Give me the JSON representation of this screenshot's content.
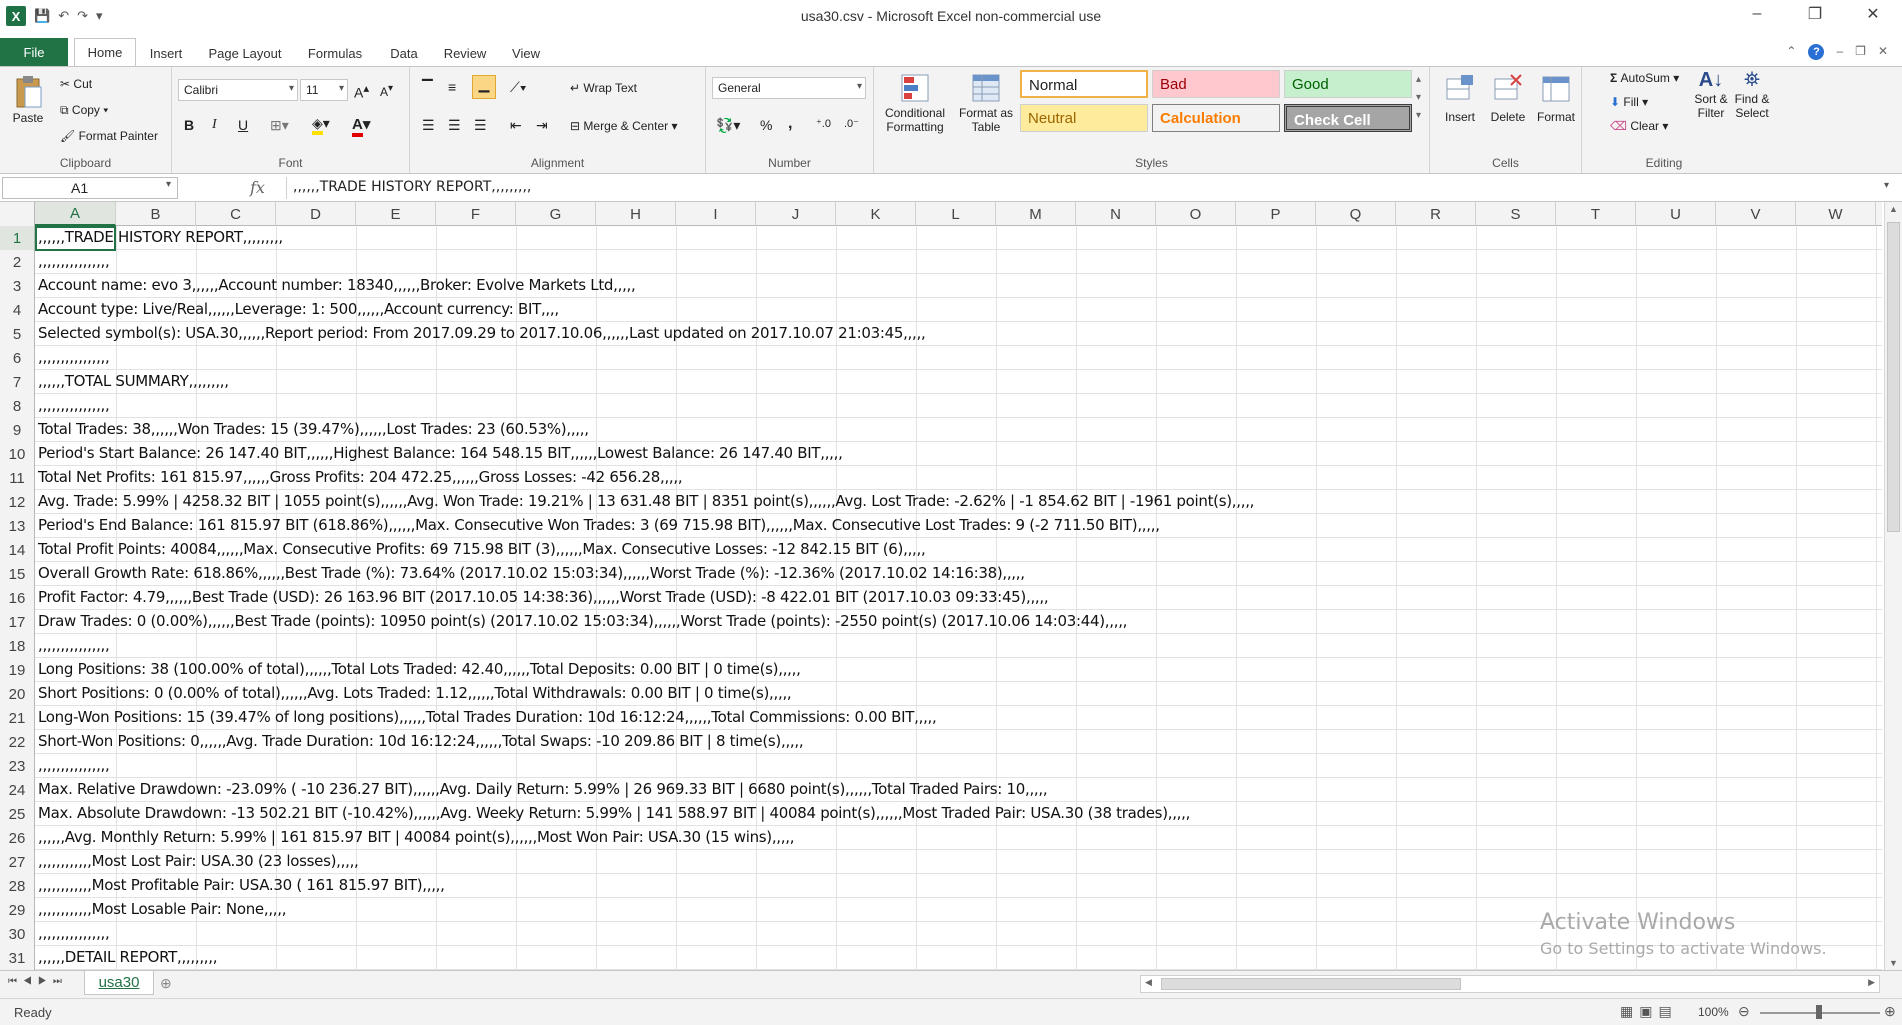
{
  "window": {
    "title": "usa30.csv - Microsoft Excel non-commercial use"
  },
  "tabs": {
    "file": "File",
    "home": "Home",
    "insert": "Insert",
    "page_layout": "Page Layout",
    "formulas": "Formulas",
    "data": "Data",
    "review": "Review",
    "view": "View"
  },
  "ribbon": {
    "clipboard": {
      "paste": "Paste",
      "cut": "Cut",
      "copy": "Copy",
      "format_painter": "Format Painter",
      "label": "Clipboard"
    },
    "font": {
      "name": "Calibri",
      "size": "11",
      "bold": "B",
      "italic": "I",
      "underline": "U",
      "label": "Font"
    },
    "alignment": {
      "wrap": "Wrap Text",
      "merge": "Merge & Center",
      "label": "Alignment"
    },
    "number": {
      "format": "General",
      "percent": "%",
      "comma": ",",
      "label": "Number"
    },
    "styles": {
      "conditional": [
        "Conditional",
        "Formatting"
      ],
      "format_as": [
        "Format as",
        "Table"
      ],
      "normal": "Normal",
      "bad": "Bad",
      "good": "Good",
      "neutral": "Neutral",
      "calculation": "Calculation",
      "check_cell": "Check Cell",
      "label": "Styles"
    },
    "cells": {
      "insert": "Insert",
      "delete": "Delete",
      "format": "Format",
      "label": "Cells"
    },
    "editing": {
      "autosum": "AutoSum",
      "fill": "Fill",
      "clear": "Clear",
      "sort": [
        "Sort &",
        "Filter"
      ],
      "find": [
        "Find &",
        "Select"
      ],
      "label": "Editing"
    }
  },
  "formula_bar": {
    "name_box": "A1",
    "fx": "fx",
    "content": ",,,,,,TRADE HISTORY REPORT,,,,,,,,,"
  },
  "columns": [
    "A",
    "B",
    "C",
    "D",
    "E",
    "F",
    "G",
    "H",
    "I",
    "J",
    "K",
    "L",
    "M",
    "N",
    "O",
    "P",
    "Q",
    "R",
    "S",
    "T",
    "U",
    "V",
    "W"
  ],
  "rows": [
    {
      "n": "1",
      "text": ",,,,,,TRADE HISTORY REPORT,,,,,,,,,"
    },
    {
      "n": "2",
      "text": ",,,,,,,,,,,,,,,,"
    },
    {
      "n": "3",
      "text": "Account name: evo 3,,,,,,Account number: 18340,,,,,,Broker: Evolve Markets Ltd,,,,,"
    },
    {
      "n": "4",
      "text": "Account type: Live/Real,,,,,,Leverage: 1: 500,,,,,,Account currency: BIT,,,,"
    },
    {
      "n": "5",
      "text": "Selected symbol(s): USA.30,,,,,,Report period: From 2017.09.29 to 2017.10.06,,,,,,Last updated on 2017.10.07 21:03:45,,,,,"
    },
    {
      "n": "6",
      "text": ",,,,,,,,,,,,,,,,"
    },
    {
      "n": "7",
      "text": ",,,,,,TOTAL SUMMARY,,,,,,,,,"
    },
    {
      "n": "8",
      "text": ",,,,,,,,,,,,,,,,"
    },
    {
      "n": "9",
      "text": "Total Trades: 38,,,,,,Won Trades: 15 (39.47%),,,,,,Lost Trades: 23 (60.53%),,,,,"
    },
    {
      "n": "10",
      "text": "Period's Start Balance: 26 147.40 BIT,,,,,,Highest Balance:  164 548.15 BIT,,,,,,Lowest Balance: 26 147.40 BIT,,,,,"
    },
    {
      "n": "11",
      "text": "Total Net Profits:  161 815.97,,,,,,Gross Profits:  204 472.25,,,,,,Gross Losses:  -42 656.28,,,,,"
    },
    {
      "n": "12",
      "text": "Avg. Trade: 5.99% | 4258.32 BIT | 1055 point(s),,,,,,Avg. Won Trade: 19.21% | 13 631.48 BIT | 8351 point(s),,,,,,Avg. Lost Trade: -2.62% | -1 854.62 BIT | -1961 point(s),,,,,"
    },
    {
      "n": "13",
      "text": "Period's End Balance:  161 815.97 BIT (618.86%),,,,,,Max. Consecutive Won Trades: 3 (69 715.98 BIT),,,,,,Max. Consecutive Lost Trades: 9 (-2 711.50 BIT),,,,,"
    },
    {
      "n": "14",
      "text": "Total Profit Points: 40084,,,,,,Max. Consecutive Profits: 69 715.98 BIT (3),,,,,,Max. Consecutive Losses:  -12 842.15 BIT (6),,,,,"
    },
    {
      "n": "15",
      "text": "Overall Growth Rate: 618.86%,,,,,,Best Trade (%): 73.64% (2017.10.02 15:03:34),,,,,,Worst Trade (%):  -12.36% (2017.10.02 14:16:38),,,,,"
    },
    {
      "n": "16",
      "text": "Profit Factor: 4.79,,,,,,Best Trade (USD): 26 163.96 BIT (2017.10.05 14:38:36),,,,,,Worst Trade (USD): -8 422.01 BIT (2017.10.03 09:33:45),,,,,"
    },
    {
      "n": "17",
      "text": "Draw Trades: 0 (0.00%),,,,,,Best Trade (points): 10950 point(s) (2017.10.02 15:03:34),,,,,,Worst Trade (points): -2550 point(s) (2017.10.06 14:03:44),,,,,"
    },
    {
      "n": "18",
      "text": ",,,,,,,,,,,,,,,,"
    },
    {
      "n": "19",
      "text": "Long Positions: 38 (100.00% of total),,,,,,Total Lots Traded: 42.40,,,,,,Total Deposits: 0.00 BIT | 0 time(s),,,,,"
    },
    {
      "n": "20",
      "text": "Short Positions: 0 (0.00% of total),,,,,,Avg. Lots Traded: 1.12,,,,,,Total Withdrawals: 0.00 BIT | 0 time(s),,,,,"
    },
    {
      "n": "21",
      "text": "Long-Won Positions: 15 (39.47% of long positions),,,,,,Total Trades Duration: 10d 16:12:24,,,,,,Total Commissions: 0.00 BIT,,,,,"
    },
    {
      "n": "22",
      "text": "Short-Won Positions: 0,,,,,,Avg. Trade Duration: 10d 16:12:24,,,,,,Total Swaps:  -10 209.86 BIT | 8 time(s),,,,,"
    },
    {
      "n": "23",
      "text": ",,,,,,,,,,,,,,,,"
    },
    {
      "n": "24",
      "text": "Max. Relative Drawdown: -23.09% ( -10 236.27 BIT),,,,,,Avg. Daily Return: 5.99% | 26 969.33 BIT | 6680 point(s),,,,,,Total Traded Pairs: 10,,,,,"
    },
    {
      "n": "25",
      "text": "Max. Absolute Drawdown:  -13 502.21 BIT (-10.42%),,,,,,Avg. Weeky Return: 5.99% |  141 588.97 BIT | 40084 point(s),,,,,,Most Traded Pair: USA.30 (38 trades),,,,,"
    },
    {
      "n": "26",
      "text": ",,,,,,Avg. Monthly Return: 5.99% |  161 815.97 BIT | 40084 point(s),,,,,,Most Won Pair: USA.30 (15 wins),,,,,"
    },
    {
      "n": "27",
      "text": ",,,,,,,,,,,,Most Lost Pair: USA.30 (23 losses),,,,,"
    },
    {
      "n": "28",
      "text": ",,,,,,,,,,,,Most Profitable Pair: USA.30 ( 161 815.97 BIT),,,,,"
    },
    {
      "n": "29",
      "text": ",,,,,,,,,,,,Most Losable Pair: None,,,,,"
    },
    {
      "n": "30",
      "text": ",,,,,,,,,,,,,,,,"
    },
    {
      "n": "31",
      "text": ",,,,,,DETAIL REPORT,,,,,,,,,"
    }
  ],
  "sheet": {
    "name": "usa30"
  },
  "status": {
    "ready": "Ready",
    "zoom": "100%"
  },
  "watermark": {
    "line1": "Activate Windows",
    "line2": "Go to Settings to activate Windows."
  }
}
